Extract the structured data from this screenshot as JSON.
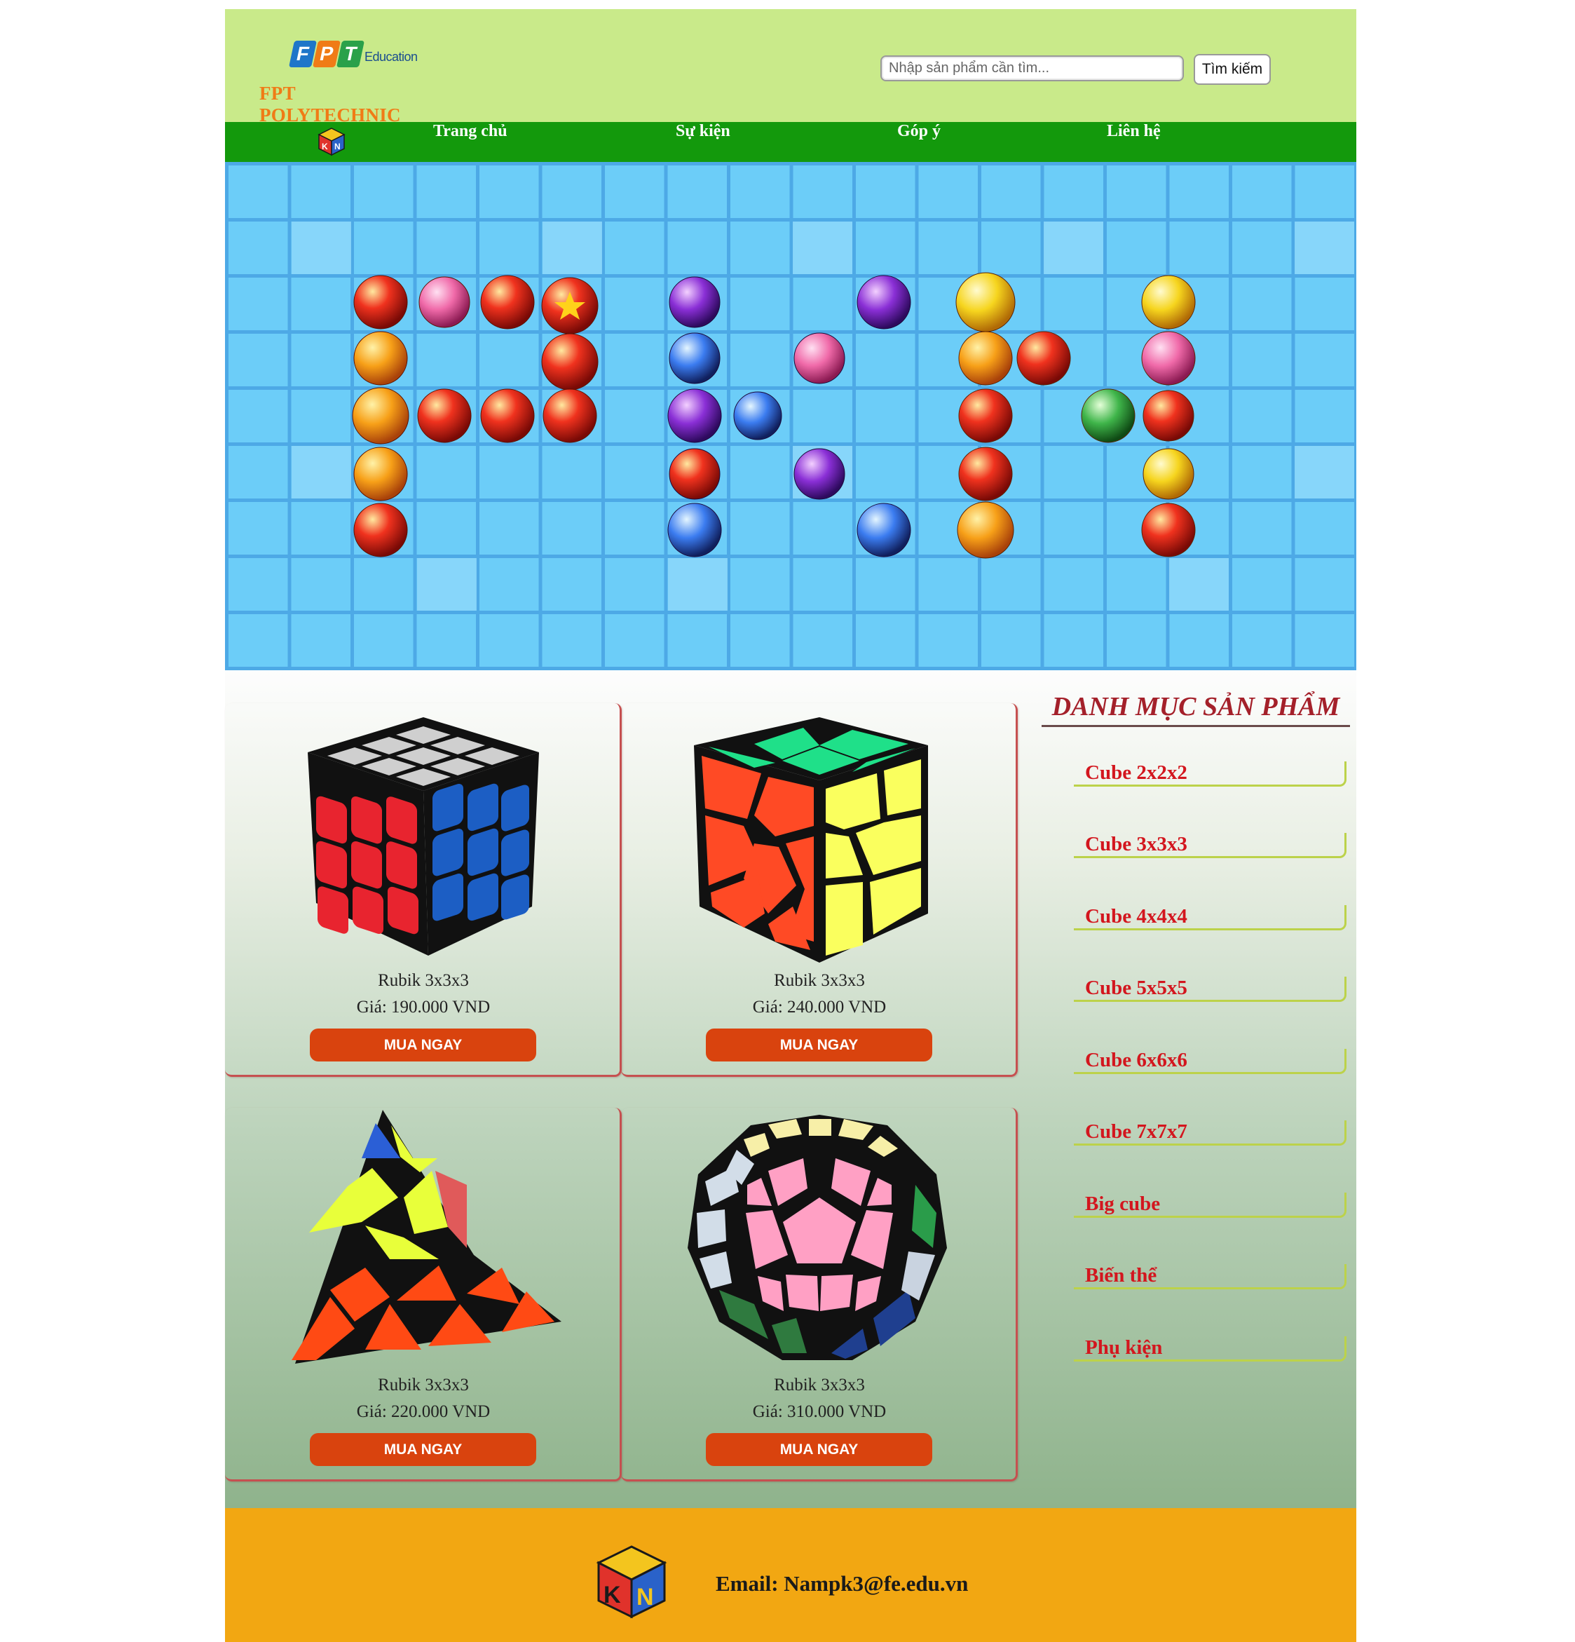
{
  "header": {
    "logo": {
      "tile_letters": [
        "F",
        "P",
        "T"
      ],
      "edu_text": "Education",
      "name": "FPT POLYTECHNIC"
    },
    "search": {
      "placeholder": "Nhập sản phẩm cần tìm...",
      "button_label": "Tìm kiếm"
    }
  },
  "nav": {
    "logo_icon": "kn-cube-logo-icon",
    "items": [
      {
        "label": "Trang chủ"
      },
      {
        "label": "Sự kiện"
      },
      {
        "label": "Góp ý"
      },
      {
        "label": "Liên hệ"
      }
    ]
  },
  "banner": {
    "image": "decorative-orb-letters-banner",
    "colors": {
      "tile": "#6ccdf8",
      "grid": "#4da9e6"
    }
  },
  "products": [
    {
      "name": "Rubik 3x3x3",
      "price": "Giá: 190.000 VND",
      "buy_label": "MUA NGAY",
      "image": "rubik-3x3x3-cube-image"
    },
    {
      "name": "Rubik 3x3x3",
      "price": "Giá: 240.000 VND",
      "buy_label": "MUA NGAY",
      "image": "skewb-cube-image"
    },
    {
      "name": "Rubik 3x3x3",
      "price": "Giá: 220.000 VND",
      "buy_label": "MUA NGAY",
      "image": "pyraminx-image"
    },
    {
      "name": "Rubik 3x3x3",
      "price": "Giá: 310.000 VND",
      "buy_label": "MUA NGAY",
      "image": "megaminx-image"
    }
  ],
  "sidebar": {
    "title": "DANH MỤC SẢN PHẨM",
    "categories": [
      {
        "label": "Cube 2x2x2"
      },
      {
        "label": "Cube 3x3x3"
      },
      {
        "label": "Cube 4x4x4"
      },
      {
        "label": "Cube 5x5x5"
      },
      {
        "label": "Cube 6x6x6"
      },
      {
        "label": "Cube 7x7x7"
      },
      {
        "label": "Big cube"
      },
      {
        "label": "Biến thể"
      },
      {
        "label": "Phụ kiện"
      }
    ]
  },
  "footer": {
    "email": "Email: Nampk3@fe.edu.vn",
    "logo_icon": "kn-cube-logo-icon"
  },
  "colors": {
    "header_bg": "#c9ea8a",
    "nav_bg": "#13990c",
    "buy_button": "#d9430e",
    "category_text": "#d3161e",
    "title_text": "#a4202a",
    "footer_bg": "#f2a712"
  }
}
